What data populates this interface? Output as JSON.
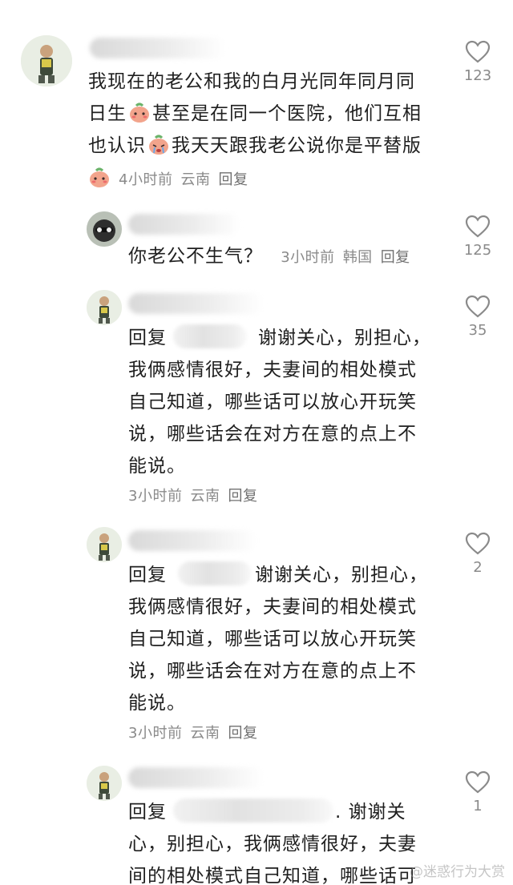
{
  "comments": [
    {
      "text_line1": "我现在的老公和我的白月光同年同月同",
      "text_line2a": "日生",
      "text_line2b": "甚至是在同一个医院，他们互相",
      "text_line3a": "也认识",
      "text_line3b": "我天天跟我老公说你是平替版",
      "time": "4小时前",
      "location": "云南",
      "reply_label": "回复",
      "likes": "123"
    },
    {
      "text": "你老公不生气？",
      "time": "3小时前",
      "location": "韩国",
      "reply_label": "回复",
      "likes": "125"
    },
    {
      "prefix": "回复",
      "text_line1": "谢谢关心，别担心，",
      "text_line2": "我俩感情很好，夫妻间的相处模式",
      "text_line3": "自己知道，哪些话可以放心开玩笑",
      "text_line4": "说，哪些话会在对方在意的点上不",
      "text_line5": "能说。",
      "time": "3小时前",
      "location": "云南",
      "reply_label": "回复",
      "likes": "35"
    },
    {
      "prefix": "回复",
      "text_line1": "谢谢关心，别担心，",
      "text_line2": "我俩感情很好，夫妻间的相处模式",
      "text_line3": "自己知道，哪些话可以放心开玩笑",
      "text_line4": "说，哪些话会在对方在意的点上不",
      "text_line5": "能说。",
      "time": "3小时前",
      "location": "云南",
      "reply_label": "回复",
      "likes": "2"
    },
    {
      "prefix": "回复",
      "text_line1": ". 谢谢关",
      "text_line2": "心，别担心，我俩感情很好，夫妻",
      "text_line3": "间的相处模式自己知道，哪些话可",
      "likes": "1"
    }
  ],
  "watermark": "@迷惑行为大赏",
  "icons": {
    "like": "heart-outline-icon",
    "sticker": "blushing-face-sticker-icon"
  }
}
